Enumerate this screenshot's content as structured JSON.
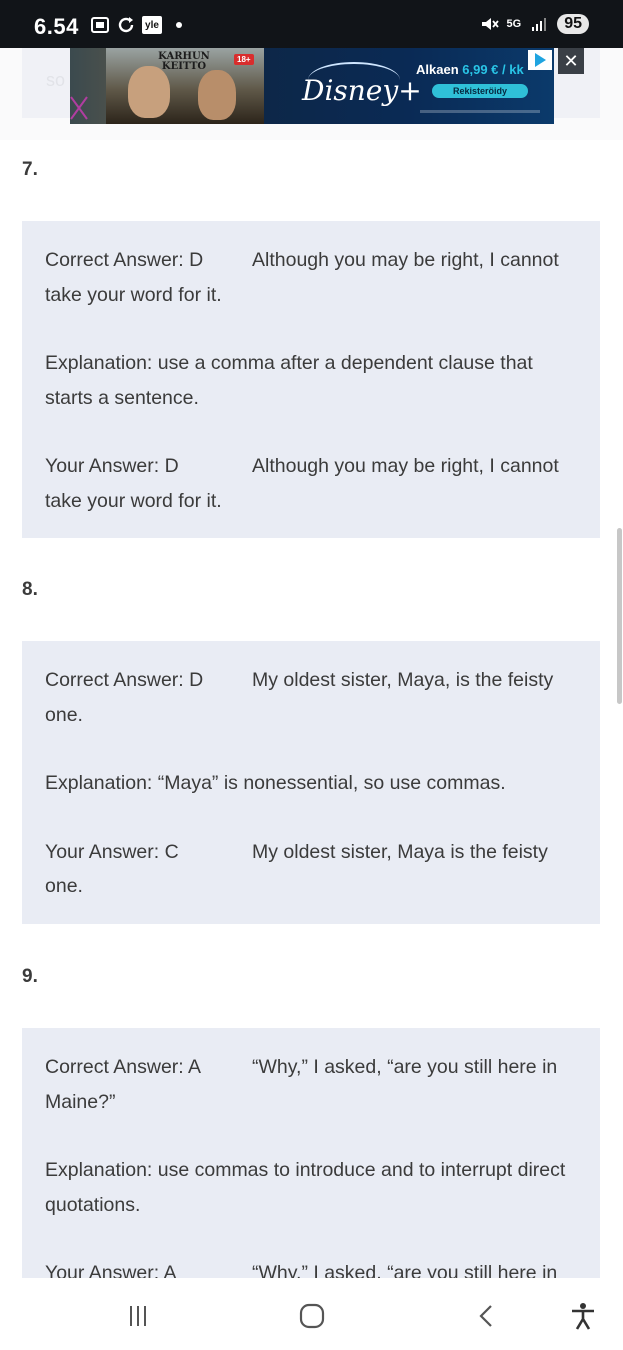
{
  "status_bar": {
    "time": "6.54",
    "app_badge": "yle",
    "network": "5G",
    "battery": "95"
  },
  "ad": {
    "poster_title": "KARHUN KEITTO",
    "age_rating": "18+",
    "brand": "Disney+",
    "price_text": "Alkaen",
    "price_value": "6,99 € / kk",
    "cta": "Rekisteröidy"
  },
  "previous_card_fragment": "so",
  "questions": [
    {
      "number": "7.",
      "correct_label": "Correct Answer: D",
      "correct_text": "Although you may be right, I cannot take your word for it.",
      "explanation": "Explanation: use a comma after a dependent clause that starts a sentence.",
      "your_label": "Your Answer: D",
      "your_text": "Although you may be right, I cannot take your word for it."
    },
    {
      "number": "8.",
      "correct_label": "Correct Answer: D",
      "correct_text": "My oldest sister, Maya, is the feisty one.",
      "explanation": "Explanation: “Maya” is nonessential, so use commas.",
      "your_label": "Your Answer: C",
      "your_text": "My oldest sister, Maya is the feisty one."
    },
    {
      "number": "9.",
      "correct_label": "Correct Answer: A",
      "correct_text": "“Why,” I asked, “are you still here in Maine?”",
      "explanation": "Explanation: use commas to introduce and to interrupt direct quotations.",
      "your_label": "Your Answer: A",
      "your_text": "“Why,” I asked, “are you still here in"
    }
  ],
  "nav": {
    "recents": "recent-apps-icon",
    "home": "home-icon",
    "back": "back-icon",
    "accessibility": "accessibility-icon"
  }
}
